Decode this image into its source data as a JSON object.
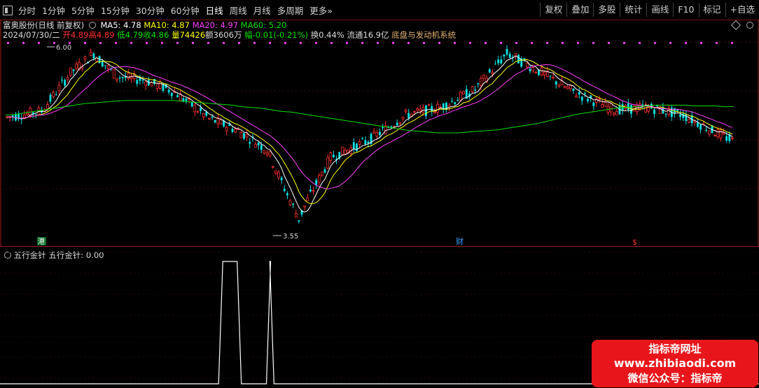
{
  "toolbar": {
    "tabs": [
      "分时",
      "1分钟",
      "5分钟",
      "15分钟",
      "30分钟",
      "60分钟",
      "日线",
      "周线",
      "月线",
      "多周期",
      "更多»"
    ],
    "active_tab": "日线",
    "right_buttons": [
      "复权",
      "叠加",
      "多股",
      "统计",
      "画线",
      "F10",
      "标记",
      "+自选"
    ]
  },
  "header": {
    "stock": "富奥股份(日线 前复权)",
    "ma5": "MA5: 4.78",
    "ma10": "MA10: 4.87",
    "ma20": "MA20: 4.97",
    "ma60": "MA60: 5.20"
  },
  "quote": {
    "date": "2024/07/30/二",
    "open": "开4.89",
    "high": "高4.89",
    "low": "低4.79",
    "close": "收4.86",
    "volume": "量74426",
    "amount": "额3606万",
    "change": "幅-0.01(-0.21%)",
    "turnover": "换0.44%",
    "float": "流通16.9亿",
    "system": "底盘与发动机系统"
  },
  "annotations": {
    "high_label": "6.00",
    "low_label": "3.55",
    "marker_gang": "港",
    "marker_cai": "财",
    "marker_dollar": "$"
  },
  "indicator": {
    "name": "五行金针",
    "value_label": "五行金针: 0.00"
  },
  "watermark": {
    "line1": "指标帝网址",
    "line2": "www.zhibiaodi.com",
    "line3": "微信公众号：指标帝"
  },
  "colors": {
    "up": "#ff3030",
    "down": "#00e0e0",
    "ma5": "#ffffff",
    "ma10": "#ffff00",
    "ma20": "#ff40ff",
    "ma60": "#00e000",
    "divider": "#a01818"
  },
  "chart_data": {
    "type": "candlestick",
    "price_range": [
      3.55,
      6.0
    ],
    "ma60": [
      5.05,
      5.06,
      5.08,
      5.1,
      5.12,
      5.14,
      5.16,
      5.18,
      5.2,
      5.21,
      5.22,
      5.23,
      5.24,
      5.24,
      5.24,
      5.24,
      5.24,
      5.24,
      5.23,
      5.22,
      5.21,
      5.2,
      5.19,
      5.18,
      5.16,
      5.15,
      5.14,
      5.12,
      5.1,
      5.09,
      5.07,
      5.05,
      5.03,
      5.01,
      4.99,
      4.97,
      4.95,
      4.93,
      4.91,
      4.89,
      4.87,
      4.85,
      4.84,
      4.83,
      4.82,
      4.82,
      4.82,
      4.83,
      4.84,
      4.85,
      4.86,
      4.88,
      4.9,
      4.92,
      4.94,
      4.97,
      5.0,
      5.03,
      5.06,
      5.08,
      5.1,
      5.12,
      5.14,
      5.15,
      5.16,
      5.17,
      5.18,
      5.18,
      5.18,
      5.18,
      5.17,
      5.17,
      5.17,
      5.16,
      5.16
    ],
    "indicator_pulses": [
      {
        "start": 0.288,
        "end": 0.318,
        "value": 1
      },
      {
        "start": 0.351,
        "end": 0.361,
        "value": 1
      }
    ]
  }
}
